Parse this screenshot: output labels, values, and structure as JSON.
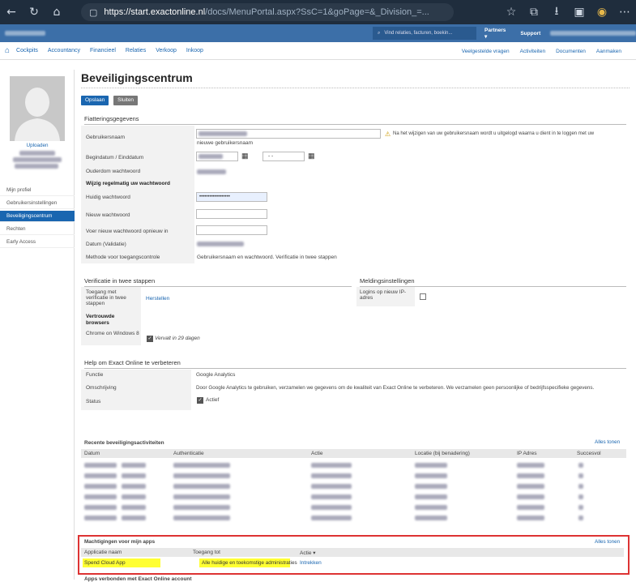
{
  "browser": {
    "url_host": "https://start.exactonline.nl",
    "url_path": "/docs/MenuPortal.aspx?SsC=1&goPage=&_Division_=..."
  },
  "topbar": {
    "search_placeholder": "Vind relaties, facturen, boekin...",
    "partners": "Partners ▾",
    "support": "Support"
  },
  "menu": {
    "items": [
      "Cockpits",
      "Accountancy",
      "Financieel",
      "Relaties",
      "Verkoop",
      "Inkoop"
    ],
    "right": [
      "Veelgestelde vragen",
      "Activiteiten",
      "Documenten",
      "Aanmaken"
    ]
  },
  "sidebar": {
    "upload": "Uploaden",
    "links": [
      "Mijn profiel",
      "Gebruikersinstellingen",
      "Beveiligingscentrum",
      "Rechten",
      "Early Access"
    ]
  },
  "page": {
    "title": "Beveiligingscentrum",
    "save": "Opslaan",
    "close": "Sluiten"
  },
  "fiattering": {
    "header": "Fiatteringsgegevens",
    "username_label": "Gebruikersnaam",
    "username_note": "nieuwe gebruikersnaam",
    "warning": "Na het wijzigen van uw gebruikersnaam wordt u uitgelogd waarna u dient in te loggen met uw",
    "dates_label": "Begindatum / Einddatum",
    "end_date": "- -",
    "pw_age_label": "Ouderdom wachtwoord",
    "change_regularly": "Wijzig regelmatig uw wachtwoord",
    "current_pw_label": "Huidig wachtwoord",
    "current_pw_value": "••••••••••••••••••",
    "new_pw_label": "Nieuw wachtwoord",
    "repeat_pw_label": "Voer nieuw wachtwoord opnieuw in",
    "validation_label": "Datum (Validatie)",
    "method_label": "Methode voor toegangscontrole",
    "method_value": "Gebruikersnaam en wachtwoord. Verificatie in twee stappen"
  },
  "twostep": {
    "header": "Verificatie in twee stappen",
    "access_label": "Toegang met verificatie in twee stappen",
    "restore": "Herstellen",
    "trusted": "Vertrouwde browsers",
    "chrome": "Chrome on Windows 8",
    "expires": "Vervalt in 29 dagen"
  },
  "notify": {
    "header": "Meldingsinstellingen",
    "logins": "Logins op nieuw IP-adres"
  },
  "help": {
    "header": "Help om Exact Online te verbeteren",
    "func_label": "Functie",
    "func_value": "Google Analytics",
    "desc_label": "Omschrijving",
    "desc_value": "Door Google Analytics te gebruiken, verzamelen we gegevens om de kwaliteit van Exact Online te verbeteren. We verzamelen geen persoonlijke of bedrijfsspecifieke gegevens.",
    "status_label": "Status",
    "status_value": "Actief"
  },
  "activity": {
    "header": "Recente beveiligingsactiviteiten",
    "show_all": "Alles tonen",
    "columns": [
      "Datum",
      "Authenticatie",
      "Actie",
      "Locatie (bij benadering)",
      "IP Adres",
      "Succesvol"
    ]
  },
  "apps": {
    "header": "Machtigingen voor mijn apps",
    "show_all": "Alles tonen",
    "columns": [
      "Applicatie naam",
      "Toegang tot",
      "Actie ▾"
    ],
    "row": {
      "name": "Spend Cloud App",
      "access": "Alle huidige en toekomstige administraties",
      "action": "Intrekken"
    },
    "footer": "Apps verbonden met Exact Online account"
  },
  "colors": {
    "blue": "#1a66b0",
    "topbar": "#3c6fa8",
    "highlight": "#ffff33",
    "redbox": "#dd3333"
  }
}
